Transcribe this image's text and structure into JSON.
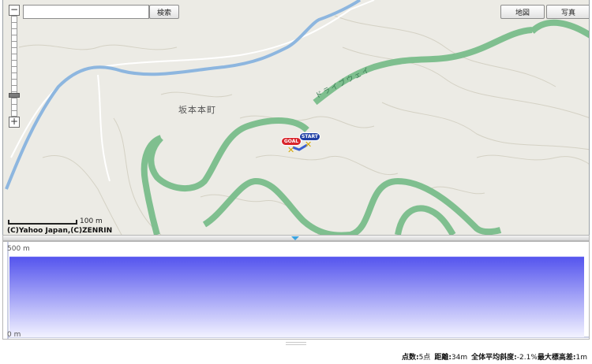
{
  "toolbar": {
    "search_value": "",
    "search_button": "検索",
    "map_button": "地図",
    "photo_button": "写真"
  },
  "map": {
    "place_name": "坂本本町",
    "road_name": "ドライブウェイ",
    "goal_marker": "GOAL",
    "start_marker": "START",
    "scale_label": "100 m",
    "copyright": "(C)Yahoo Japan,(C)ZENRIN",
    "colors": {
      "background": "#ecebe5",
      "road": "#7fbf8f",
      "river": "#8db6df",
      "contour": "#d4d1c4",
      "route": "#3a5fd0"
    }
  },
  "zoom": {
    "plus_icon": "+",
    "minus_icon": "−"
  },
  "profile": {
    "y_max_label": "500 m",
    "y_min_label": "0 m",
    "fill_color": "#5f5ff0"
  },
  "chart_data": {
    "type": "area",
    "ylim": [
      0,
      500
    ],
    "x": [
      0,
      34
    ],
    "y": [
      450,
      450
    ]
  },
  "stats": {
    "points_label": "点数:",
    "points_value": "5点",
    "distance_label": "距離:",
    "distance_value": "34m",
    "slope_label": "全体平均斜度:",
    "slope_value": "-2.1%",
    "elev_label": "最大標高差:",
    "elev_value": "1m"
  }
}
